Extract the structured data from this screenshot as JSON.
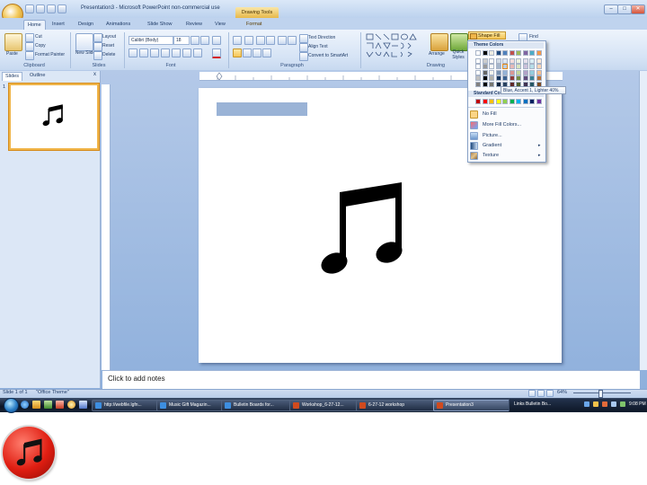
{
  "titlebar": {
    "title": "Presentation3 - Microsoft PowerPoint non-commercial use",
    "context_tab": "Drawing Tools",
    "minimize": "–",
    "maximize": "□",
    "close": "✕"
  },
  "tabs": [
    "Home",
    "Insert",
    "Design",
    "Animations",
    "Slide Show",
    "Review",
    "View",
    "Format"
  ],
  "ribbon": {
    "clipboard": {
      "paste": "Paste",
      "cut": "Cut",
      "copy": "Copy",
      "format_painter": "Format Painter",
      "label": "Clipboard"
    },
    "slides": {
      "new_slide": "New Slide",
      "layout": "Layout",
      "reset": "Reset",
      "delete": "Delete",
      "label": "Slides"
    },
    "font": {
      "font_name": "Calibri (Body)",
      "font_size": "18",
      "label": "Font"
    },
    "paragraph": {
      "text_direction": "Text Direction",
      "align_text": "Align Text",
      "convert_smartart": "Convert to SmartArt",
      "label": "Paragraph"
    },
    "drawing": {
      "arrange": "Arrange",
      "quick_styles": "Quick Styles",
      "shape_fill": "Shape Fill",
      "label": "Drawing"
    },
    "editing": {
      "find": "Find"
    }
  },
  "shape_fill_menu": {
    "theme_colors": "Theme Colors",
    "standard_colors": "Standard Colors",
    "tooltip": "Blue, Accent 1, Lighter 40%",
    "no_fill": "No Fill",
    "more_fill_colors": "More Fill Colors...",
    "picture": "Picture...",
    "gradient": "Gradient",
    "texture": "Texture",
    "theme_palette": [
      "#ffffff",
      "#000000",
      "#eeece1",
      "#1f497d",
      "#4f81bd",
      "#c0504d",
      "#9bbb59",
      "#8064a2",
      "#4bacc6",
      "#f79646"
    ],
    "standard_palette": [
      "#c00000",
      "#ff0000",
      "#ffc000",
      "#ffff00",
      "#92d050",
      "#00b050",
      "#00b0f0",
      "#0070c0",
      "#002060",
      "#7030a0"
    ]
  },
  "panel_tabs": {
    "slides": "Slides",
    "outline": "Outline",
    "close": "x"
  },
  "thumbnail": {
    "number": "1"
  },
  "notes": {
    "placeholder": "Click to add notes"
  },
  "status": {
    "slide_info": "Slide 1 of 1",
    "theme": "\"Office Theme\"",
    "zoom": "64%"
  },
  "taskbar": {
    "items": [
      {
        "label": "http://webfile.lgfn...",
        "color": "#3d8ee0"
      },
      {
        "label": "Music Gift Magazin...",
        "color": "#3d8ee0"
      },
      {
        "label": "Bulletin Boards for...",
        "color": "#3d8ee0"
      },
      {
        "label": "Workshop_6-27-12...",
        "color": "#d04a1e"
      },
      {
        "label": "6-27-12 workshop",
        "color": "#d04a1e"
      },
      {
        "label": "Presentation3",
        "color": "#d04a1e"
      }
    ],
    "tray": "Links  Bulletin Bo...",
    "clock": "9:08 PM"
  },
  "colors": {
    "ribbon_bg": "#d5e3f5",
    "workspace_bg": "#9db9e0",
    "selection_orange": "#f0b54a",
    "textbox_fill": "#9ab3d6"
  }
}
